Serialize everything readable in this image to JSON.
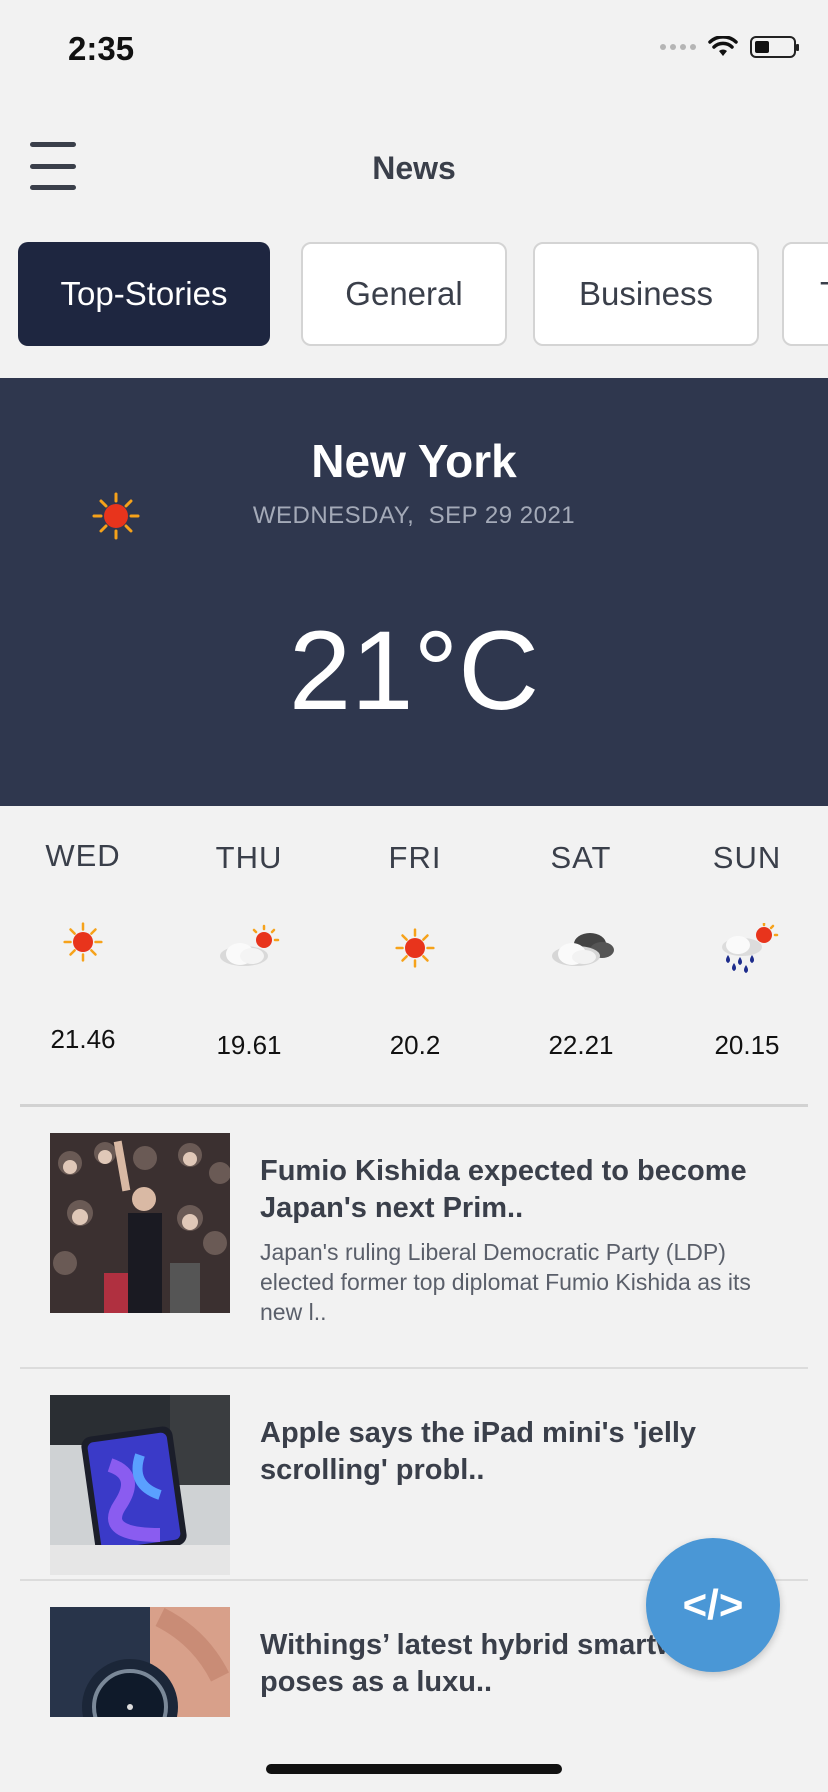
{
  "status_bar": {
    "time": "2:35"
  },
  "header": {
    "title": "News",
    "menu_icon": "hamburger-menu-icon"
  },
  "tabs": [
    {
      "label": "Top-Stories",
      "active": true
    },
    {
      "label": "General",
      "active": false
    },
    {
      "label": "Business",
      "active": false
    },
    {
      "label": "T",
      "active": false
    }
  ],
  "weather": {
    "city": "New York",
    "date": "WEDNESDAY,  SEP 29 2021",
    "temperature": "21°C",
    "icon": "sun-icon"
  },
  "forecast": [
    {
      "day": "WED",
      "icon": "sun-icon",
      "value": "21.46"
    },
    {
      "day": "THU",
      "icon": "cloud-sun-icon",
      "value": "19.61"
    },
    {
      "day": "FRI",
      "icon": "sun-icon",
      "value": "20.2"
    },
    {
      "day": "SAT",
      "icon": "cloud-icon",
      "value": "22.21"
    },
    {
      "day": "SUN",
      "icon": "rain-sun-icon",
      "value": "20.15"
    }
  ],
  "news": [
    {
      "title": "Fumio Kishida expected to become Japan's next Prim..",
      "description": "Japan's ruling Liberal Democratic Party (LDP) elected former top diplomat Fumio Kishida as its new l.."
    },
    {
      "title": "Apple says the iPad mini's 'jelly scrolling' probl..",
      "description": ""
    },
    {
      "title": "Withings’ latest hybrid smartwatch poses as a luxu..",
      "description": ""
    }
  ],
  "fab": {
    "label": "</>",
    "icon": "code-icon"
  },
  "colors": {
    "header_dark": "#2f374e",
    "tab_active": "#1e2640",
    "fab": "#4a97d6"
  }
}
